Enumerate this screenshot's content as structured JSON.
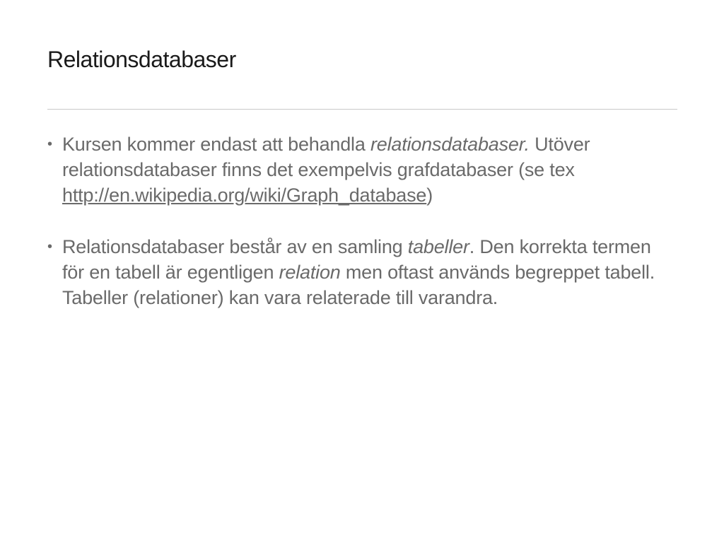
{
  "slide": {
    "title": "Relationsdatabaser",
    "bullets": [
      {
        "text_1": "Kursen kommer endast att behandla ",
        "italic_1": "relationsdatabaser.",
        "text_2": " Utöver relationsdatabaser finns det exempelvis grafdatabaser (se tex ",
        "link": "http://en.wikipedia.org/wiki/Graph_database",
        "text_3": ")"
      },
      {
        "text_1": "Relationsdatabaser består av en samling ",
        "italic_1": "tabeller",
        "text_2": ". Den korrekta termen för en tabell är egentligen ",
        "italic_2": "relation",
        "text_3": " men oftast används begreppet tabell. Tabeller (relationer) kan vara relaterade till varandra."
      }
    ],
    "bullet_glyph": "•"
  }
}
